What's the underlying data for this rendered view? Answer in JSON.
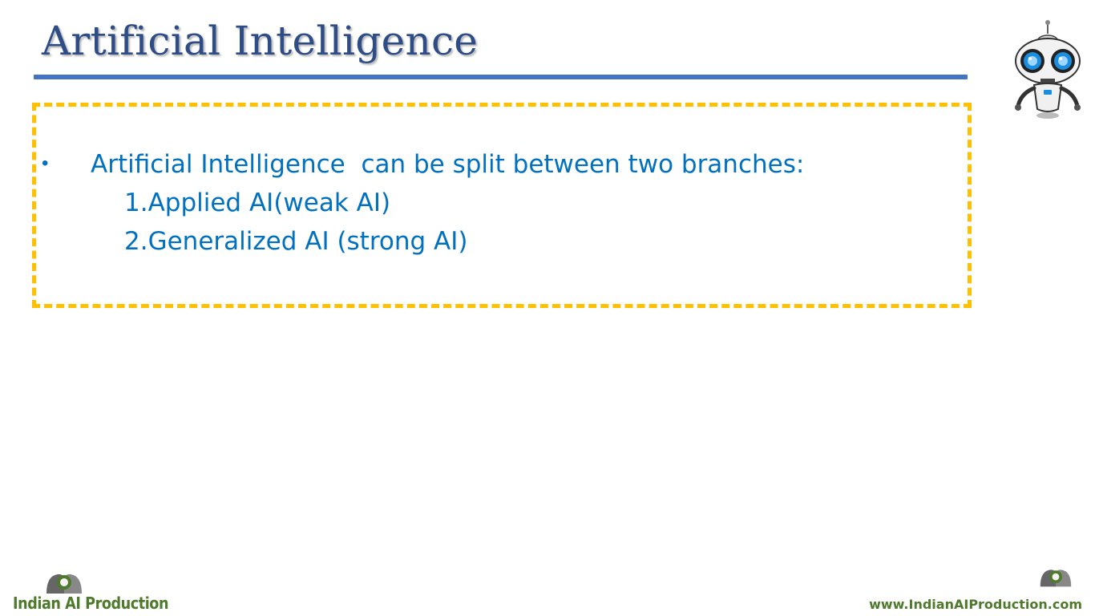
{
  "slide": {
    "title": "Artificial Intelligence",
    "bullet": "Artificial Intelligence  can be split between two branches:",
    "sub_items": [
      "1.Applied AI(weak AI)",
      "2.Generalized AI (strong AI)"
    ]
  },
  "branding": {
    "logo_text": "Indian AI Production",
    "website": "www.IndianAIProduction.com"
  },
  "icons": {
    "robot": "robot-mascot-icon",
    "brand": "brain-heads-logo-icon"
  },
  "colors": {
    "title": "#2e4c86",
    "rule": "#4472c4",
    "body_text": "#0070c0",
    "box_border": "#ffc000",
    "brand_green": "#4e7a2b"
  }
}
